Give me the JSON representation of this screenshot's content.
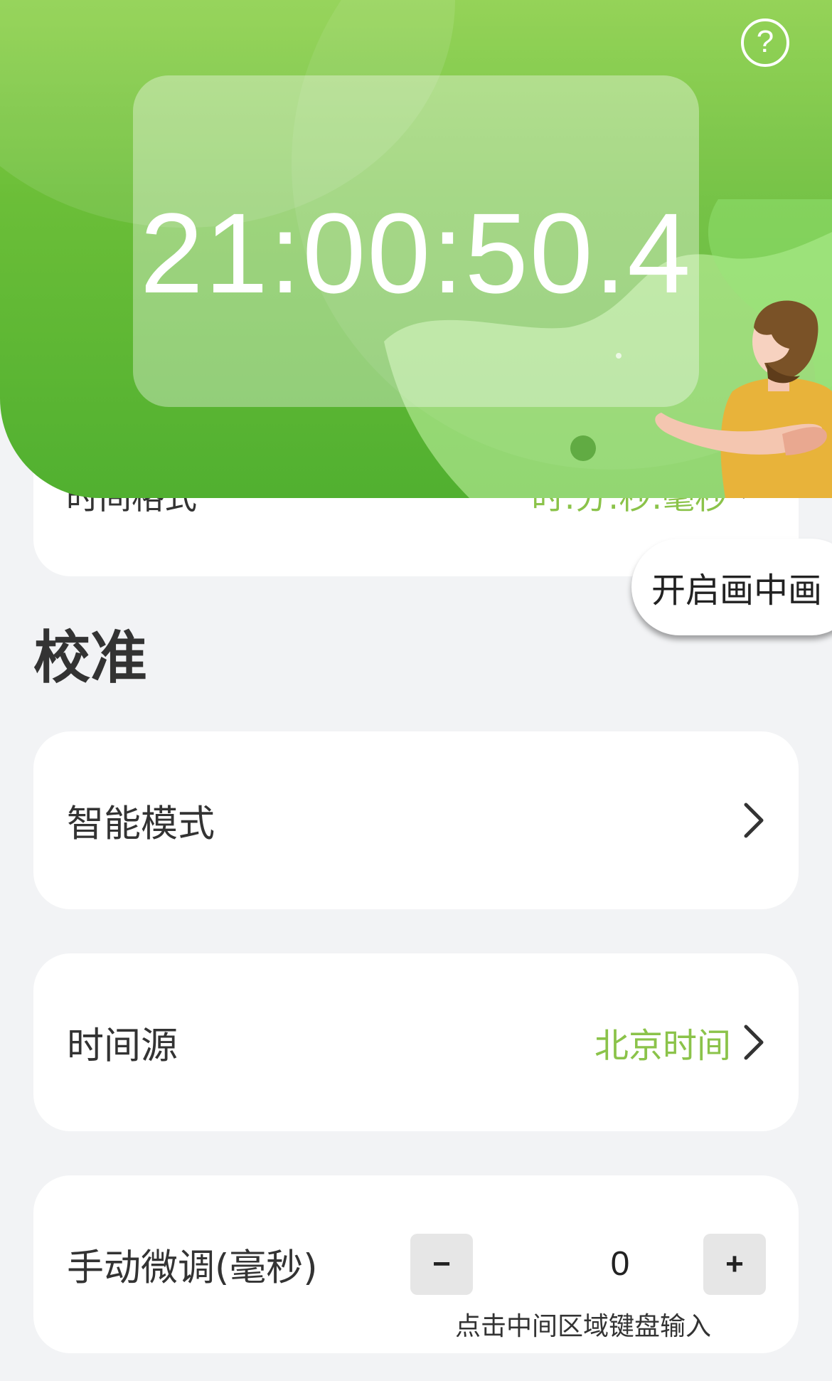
{
  "header": {
    "clock": "21:00:50.4",
    "help_symbol": "?"
  },
  "format_row": {
    "label": "时间格式",
    "value": "时:分:秒.毫秒"
  },
  "pip_button": {
    "label": "开启画中画"
  },
  "calibration": {
    "title": "校准",
    "smart_mode": {
      "label": "智能模式"
    },
    "time_source": {
      "label": "时间源",
      "value": "北京时间"
    },
    "manual_adjust": {
      "label": "手动微调(毫秒)",
      "minus": "−",
      "value": "0",
      "plus": "+",
      "hint": "点击中间区域键盘输入"
    }
  },
  "colors": {
    "accent_green": "#8BC34A",
    "header_green": "#6BBE38",
    "background": "#F2F3F5"
  },
  "icons": [
    "help-icon",
    "chevron-right-icon",
    "person-illustration"
  ]
}
